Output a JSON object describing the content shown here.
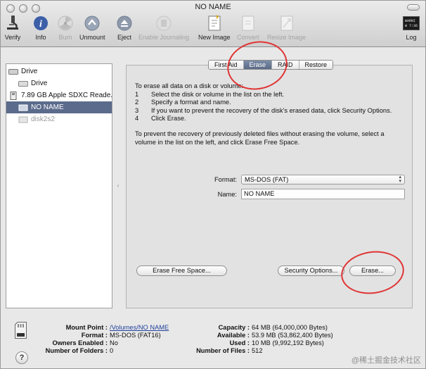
{
  "window": {
    "title": "NO NAME"
  },
  "toolbar": {
    "verify": "Verify",
    "info": "Info",
    "burn": "Burn",
    "unmount": "Unmount",
    "eject": "Eject",
    "enable_journaling": "Enable Journaling",
    "new_image": "New Image",
    "convert": "Convert",
    "resize_image": "Resize Image",
    "log": "Log",
    "log_icon_text": "WARNI\nW 7:36"
  },
  "sidebar": {
    "items": [
      {
        "label": "Drive"
      },
      {
        "label": "Drive"
      },
      {
        "label": "7.89 GB Apple SDXC Reade..."
      },
      {
        "label": "NO NAME"
      },
      {
        "label": "disk2s2"
      }
    ]
  },
  "tabs": [
    "First Aid",
    "Erase",
    "RAID",
    "Restore"
  ],
  "erase": {
    "intro": "To erase all data on a disk or volume:",
    "steps": [
      {
        "num": "1",
        "text": "Select the disk or volume in the list on the left."
      },
      {
        "num": "2",
        "text": "Specify a format and name."
      },
      {
        "num": "3",
        "text": "If you want to prevent the recovery of the disk's erased data, click Security Options."
      },
      {
        "num": "4",
        "text": "Click Erase."
      }
    ],
    "free_space_text": "To prevent the recovery of previously deleted files without erasing the volume, select a volume in the list on the left, and click Erase Free Space.",
    "format_label": "Format:",
    "format_value": "MS-DOS (FAT)",
    "name_label": "Name:",
    "name_value": "NO NAME",
    "erase_free_space_button": "Erase Free Space...",
    "security_options_button": "Security Options...",
    "erase_button": "Erase..."
  },
  "info": {
    "mount_point_key": "Mount Point :",
    "mount_point_val": "/Volumes/NO NAME",
    "format_key": "Format :",
    "format_val": "MS-DOS (FAT16)",
    "owners_key": "Owners Enabled :",
    "owners_val": "No",
    "folders_key": "Number of Folders :",
    "folders_val": "0",
    "capacity_key": "Capacity :",
    "capacity_val": "64 MB (64,000,000 Bytes)",
    "available_key": "Available :",
    "available_val": "53.9 MB (53,862,400 Bytes)",
    "used_key": "Used :",
    "used_val": "10 MB (9,992,192 Bytes)",
    "files_key": "Number of Files :",
    "files_val": "512"
  },
  "help": "?",
  "watermark": "@稀土掘金技术社区",
  "colors": {
    "selection": "#5b6b8b",
    "annotation": "#e03535",
    "link": "#1f3f9c"
  }
}
